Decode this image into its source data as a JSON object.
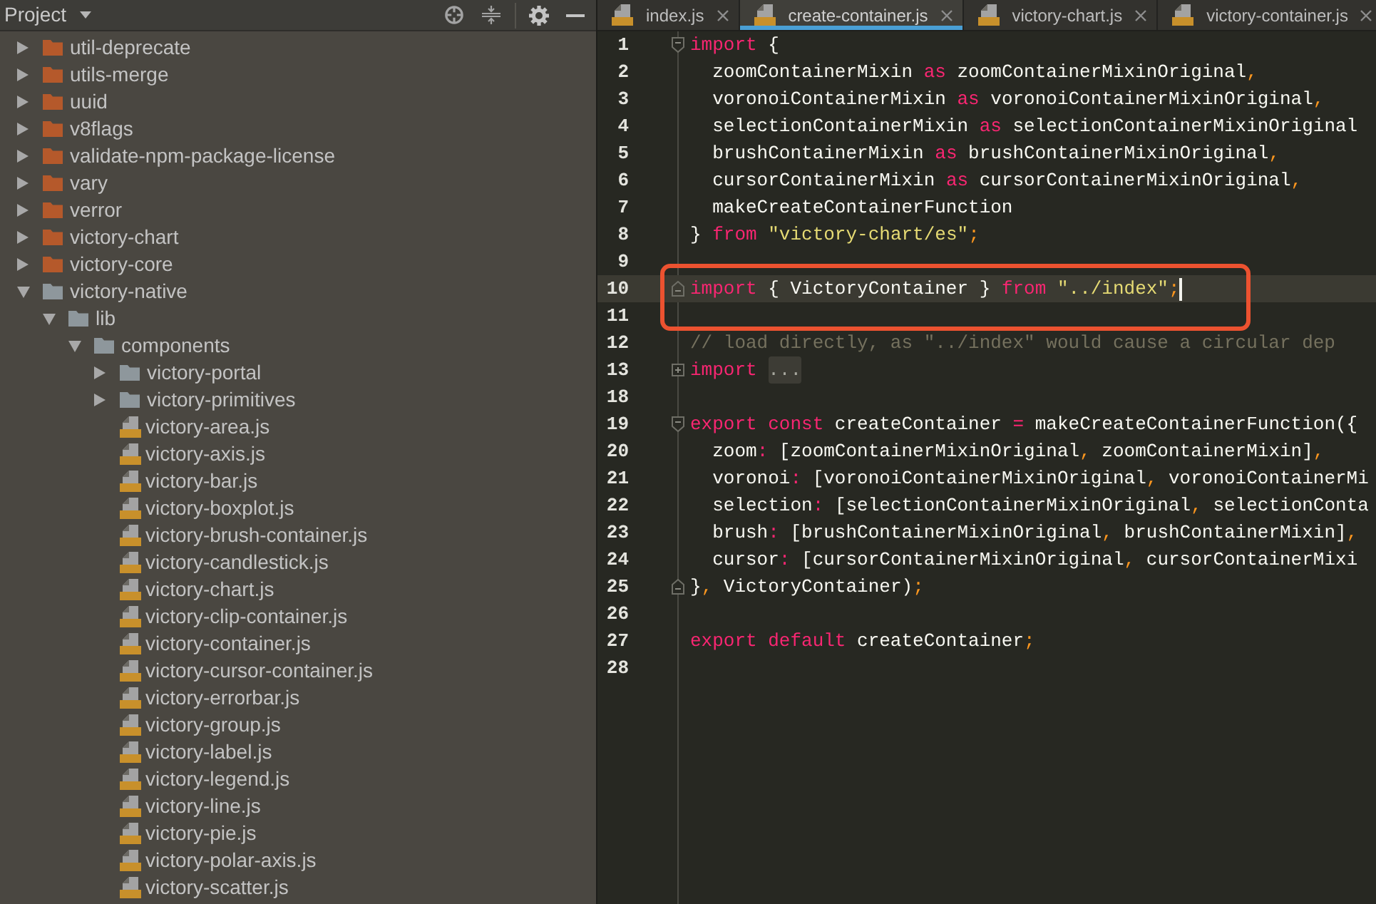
{
  "project_panel": {
    "title": "Project",
    "tree": [
      {
        "label": "util-deprecate",
        "kind": "folder",
        "color": "#b5592b",
        "expanded": false
      },
      {
        "label": "utils-merge",
        "kind": "folder",
        "color": "#b5592b",
        "expanded": false
      },
      {
        "label": "uuid",
        "kind": "folder",
        "color": "#b5592b",
        "expanded": false
      },
      {
        "label": "v8flags",
        "kind": "folder",
        "color": "#b5592b",
        "expanded": false
      },
      {
        "label": "validate-npm-package-license",
        "kind": "folder",
        "color": "#b5592b",
        "expanded": false
      },
      {
        "label": "vary",
        "kind": "folder",
        "color": "#b5592b",
        "expanded": false
      },
      {
        "label": "verror",
        "kind": "folder",
        "color": "#b5592b",
        "expanded": false
      },
      {
        "label": "victory-chart",
        "kind": "folder",
        "color": "#b5592b",
        "expanded": false
      },
      {
        "label": "victory-core",
        "kind": "folder",
        "color": "#b5592b",
        "expanded": false
      },
      {
        "label": "victory-native",
        "kind": "folder",
        "color": "#8e979c",
        "expanded": true,
        "children": [
          {
            "label": "lib",
            "kind": "folder",
            "color": "#8e979c",
            "expanded": true,
            "children": [
              {
                "label": "components",
                "kind": "folder",
                "color": "#8e979c",
                "expanded": true,
                "children": [
                  {
                    "label": "victory-portal",
                    "kind": "folder",
                    "color": "#8e979c",
                    "expanded": false
                  },
                  {
                    "label": "victory-primitives",
                    "kind": "folder",
                    "color": "#8e979c",
                    "expanded": false
                  },
                  {
                    "label": "victory-area.js",
                    "kind": "file"
                  },
                  {
                    "label": "victory-axis.js",
                    "kind": "file"
                  },
                  {
                    "label": "victory-bar.js",
                    "kind": "file"
                  },
                  {
                    "label": "victory-boxplot.js",
                    "kind": "file"
                  },
                  {
                    "label": "victory-brush-container.js",
                    "kind": "file"
                  },
                  {
                    "label": "victory-candlestick.js",
                    "kind": "file"
                  },
                  {
                    "label": "victory-chart.js",
                    "kind": "file"
                  },
                  {
                    "label": "victory-clip-container.js",
                    "kind": "file"
                  },
                  {
                    "label": "victory-container.js",
                    "kind": "file"
                  },
                  {
                    "label": "victory-cursor-container.js",
                    "kind": "file"
                  },
                  {
                    "label": "victory-errorbar.js",
                    "kind": "file"
                  },
                  {
                    "label": "victory-group.js",
                    "kind": "file"
                  },
                  {
                    "label": "victory-label.js",
                    "kind": "file"
                  },
                  {
                    "label": "victory-legend.js",
                    "kind": "file"
                  },
                  {
                    "label": "victory-line.js",
                    "kind": "file"
                  },
                  {
                    "label": "victory-pie.js",
                    "kind": "file"
                  },
                  {
                    "label": "victory-polar-axis.js",
                    "kind": "file"
                  },
                  {
                    "label": "victory-scatter.js",
                    "kind": "file"
                  }
                ]
              }
            ]
          }
        ]
      }
    ]
  },
  "editor": {
    "tabs": [
      {
        "label": "index.js",
        "selected": false
      },
      {
        "label": "create-container.js",
        "selected": true
      },
      {
        "label": "victory-chart.js",
        "selected": false
      },
      {
        "label": "victory-container.js",
        "selected": false
      }
    ],
    "lines": [
      {
        "number": "1",
        "kind": "opener",
        "current": false,
        "boxed": false,
        "tokens": [
          {
            "text": "import",
            "kind": "keyword"
          },
          {
            "text": " {",
            "kind": "plain"
          }
        ]
      },
      {
        "number": "2",
        "kind": "plain",
        "current": false,
        "boxed": false,
        "tokens": [
          {
            "text": "  zoomContainerMixin ",
            "kind": "plain"
          },
          {
            "text": "as",
            "kind": "keyword"
          },
          {
            "text": " zoomContainerMixinOriginal",
            "kind": "plain"
          },
          {
            "text": ",",
            "kind": "punct"
          }
        ]
      },
      {
        "number": "3",
        "kind": "plain",
        "current": false,
        "boxed": false,
        "tokens": [
          {
            "text": "  voronoiContainerMixin ",
            "kind": "plain"
          },
          {
            "text": "as",
            "kind": "keyword"
          },
          {
            "text": " voronoiContainerMixinOriginal",
            "kind": "plain"
          },
          {
            "text": ",",
            "kind": "punct"
          }
        ]
      },
      {
        "number": "4",
        "kind": "plain",
        "current": false,
        "boxed": false,
        "tokens": [
          {
            "text": "  selectionContainerMixin ",
            "kind": "plain"
          },
          {
            "text": "as",
            "kind": "keyword"
          },
          {
            "text": " selectionContainerMixinOriginal",
            "kind": "plain"
          }
        ]
      },
      {
        "number": "5",
        "kind": "plain",
        "current": false,
        "boxed": false,
        "tokens": [
          {
            "text": "  brushContainerMixin ",
            "kind": "plain"
          },
          {
            "text": "as",
            "kind": "keyword"
          },
          {
            "text": " brushContainerMixinOriginal",
            "kind": "plain"
          },
          {
            "text": ",",
            "kind": "punct"
          }
        ]
      },
      {
        "number": "6",
        "kind": "plain",
        "current": false,
        "boxed": false,
        "tokens": [
          {
            "text": "  cursorContainerMixin ",
            "kind": "plain"
          },
          {
            "text": "as",
            "kind": "keyword"
          },
          {
            "text": " cursorContainerMixinOriginal",
            "kind": "plain"
          },
          {
            "text": ",",
            "kind": "punct"
          }
        ]
      },
      {
        "number": "7",
        "kind": "plain",
        "current": false,
        "boxed": false,
        "tokens": [
          {
            "text": "  makeCreateContainerFunction",
            "kind": "plain"
          }
        ]
      },
      {
        "number": "8",
        "kind": "plain",
        "current": false,
        "boxed": false,
        "tokens": [
          {
            "text": "} ",
            "kind": "plain"
          },
          {
            "text": "from ",
            "kind": "keyword"
          },
          {
            "text": "\"victory-chart/es\"",
            "kind": "string"
          },
          {
            "text": ";",
            "kind": "punct"
          }
        ]
      },
      {
        "number": "9",
        "kind": "plain",
        "current": false,
        "boxed": false
      },
      {
        "number": "10",
        "kind": "closer",
        "current": true,
        "boxed": true,
        "tokens": [
          {
            "text": "import",
            "kind": "keyword"
          },
          {
            "text": " { VictoryContainer } ",
            "kind": "plain"
          },
          {
            "text": "from ",
            "kind": "keyword"
          },
          {
            "text": "\"../index\"",
            "kind": "string"
          },
          {
            "text": ";",
            "kind": "punct"
          }
        ]
      },
      {
        "number": "11",
        "kind": "plain",
        "current": false,
        "boxed": true
      },
      {
        "number": "12",
        "kind": "plain",
        "current": false,
        "boxed": false,
        "tokens": [
          {
            "text": "// load directly, as \"../index\" would cause a circular dep",
            "kind": "comment"
          }
        ]
      },
      {
        "number": "13",
        "kind": "collapsed",
        "current": false,
        "boxed": false,
        "tokens": [
          {
            "text": "import ",
            "kind": "keyword"
          },
          {
            "text": "...",
            "kind": "folded"
          }
        ]
      },
      {
        "number": "18",
        "kind": "plain",
        "current": false,
        "boxed": false
      },
      {
        "number": "19",
        "kind": "opener",
        "current": false,
        "boxed": false,
        "tokens": [
          {
            "text": "export const",
            "kind": "keyword"
          },
          {
            "text": " createContainer ",
            "kind": "plain"
          },
          {
            "text": "=",
            "kind": "operator"
          },
          {
            "text": " makeCreateContainerFunction({",
            "kind": "plain"
          }
        ]
      },
      {
        "number": "20",
        "kind": "plain",
        "current": false,
        "boxed": false,
        "tokens": [
          {
            "text": "  zoom",
            "kind": "plain"
          },
          {
            "text": ":",
            "kind": "operator"
          },
          {
            "text": " [zoomContainerMixinOriginal",
            "kind": "plain"
          },
          {
            "text": ",",
            "kind": "punct"
          },
          {
            "text": " zoomContainerMixin]",
            "kind": "plain"
          },
          {
            "text": ",",
            "kind": "punct"
          }
        ]
      },
      {
        "number": "21",
        "kind": "plain",
        "current": false,
        "boxed": false,
        "tokens": [
          {
            "text": "  voronoi",
            "kind": "plain"
          },
          {
            "text": ":",
            "kind": "operator"
          },
          {
            "text": " [voronoiContainerMixinOriginal",
            "kind": "plain"
          },
          {
            "text": ",",
            "kind": "punct"
          },
          {
            "text": " voronoiContainerMi",
            "kind": "plain"
          }
        ]
      },
      {
        "number": "22",
        "kind": "plain",
        "current": false,
        "boxed": false,
        "tokens": [
          {
            "text": "  selection",
            "kind": "plain"
          },
          {
            "text": ":",
            "kind": "operator"
          },
          {
            "text": " [selectionContainerMixinOriginal",
            "kind": "plain"
          },
          {
            "text": ",",
            "kind": "punct"
          },
          {
            "text": " selectionConta",
            "kind": "plain"
          }
        ]
      },
      {
        "number": "23",
        "kind": "plain",
        "current": false,
        "boxed": false,
        "tokens": [
          {
            "text": "  brush",
            "kind": "plain"
          },
          {
            "text": ":",
            "kind": "operator"
          },
          {
            "text": " [brushContainerMixinOriginal",
            "kind": "plain"
          },
          {
            "text": ",",
            "kind": "punct"
          },
          {
            "text": " brushContainerMixin]",
            "kind": "plain"
          },
          {
            "text": ",",
            "kind": "punct"
          }
        ]
      },
      {
        "number": "24",
        "kind": "plain",
        "current": false,
        "boxed": false,
        "tokens": [
          {
            "text": "  cursor",
            "kind": "plain"
          },
          {
            "text": ":",
            "kind": "operator"
          },
          {
            "text": " [cursorContainerMixinOriginal",
            "kind": "plain"
          },
          {
            "text": ",",
            "kind": "punct"
          },
          {
            "text": " cursorContainerMixi",
            "kind": "plain"
          }
        ]
      },
      {
        "number": "25",
        "kind": "closer",
        "current": false,
        "boxed": false,
        "tokens": [
          {
            "text": "}",
            "kind": "plain"
          },
          {
            "text": ",",
            "kind": "punct"
          },
          {
            "text": " VictoryContainer)",
            "kind": "plain"
          },
          {
            "text": ";",
            "kind": "punct"
          }
        ]
      },
      {
        "number": "26",
        "kind": "plain",
        "current": false,
        "boxed": false
      },
      {
        "number": "27",
        "kind": "plain",
        "current": false,
        "boxed": false,
        "tokens": [
          {
            "text": "export default",
            "kind": "keyword"
          },
          {
            "text": " createContainer",
            "kind": "plain"
          },
          {
            "text": ";",
            "kind": "punct"
          }
        ]
      },
      {
        "number": "28",
        "kind": "plain",
        "current": false,
        "boxed": false
      }
    ]
  }
}
